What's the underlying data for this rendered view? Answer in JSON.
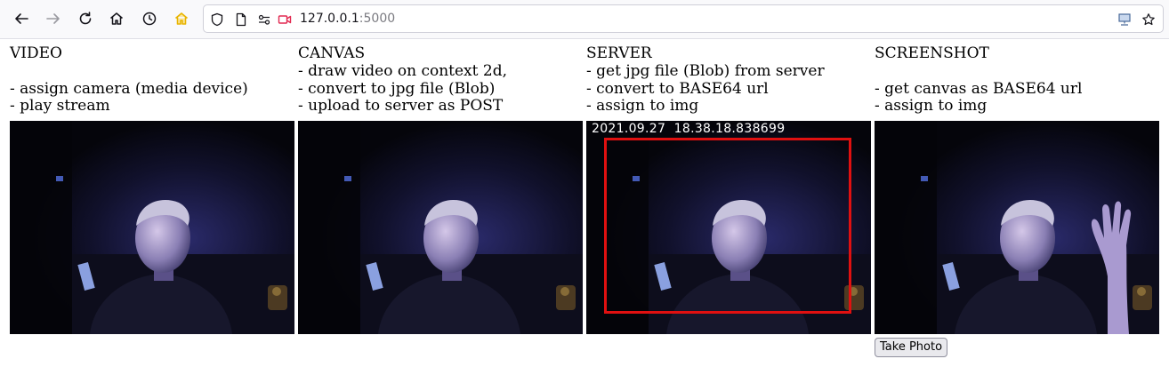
{
  "browser": {
    "url_host": "127.0.0.1",
    "url_port": ":5000",
    "icons": [
      "back-icon",
      "forward-icon",
      "reload-icon",
      "home-icon",
      "history-icon",
      "bookmark-home-icon",
      "shield-icon",
      "page-icon",
      "permissions-icon",
      "camera-active-icon",
      "network-icon",
      "bookmark-star-icon"
    ]
  },
  "columns": [
    {
      "title": "VIDEO",
      "lines": [
        "",
        "- assign camera (media device)",
        "- play stream"
      ]
    },
    {
      "title": "CANVAS",
      "lines": [
        "- draw video on context 2d,",
        "- convert to jpg file (Blob)",
        "- upload to server as POST"
      ]
    },
    {
      "title": "SERVER",
      "lines": [
        "- get jpg file (Blob) from server",
        "- convert to BASE64 url",
        "- assign to img"
      ]
    },
    {
      "title": "SCREENSHOT",
      "lines": [
        "",
        "- get canvas as BASE64 url",
        "- assign to img"
      ]
    }
  ],
  "server_frame": {
    "timestamp": "2021.09.27  18.38.18.838699",
    "box_color": "#e01010"
  },
  "take_photo_label": "Take Photo"
}
